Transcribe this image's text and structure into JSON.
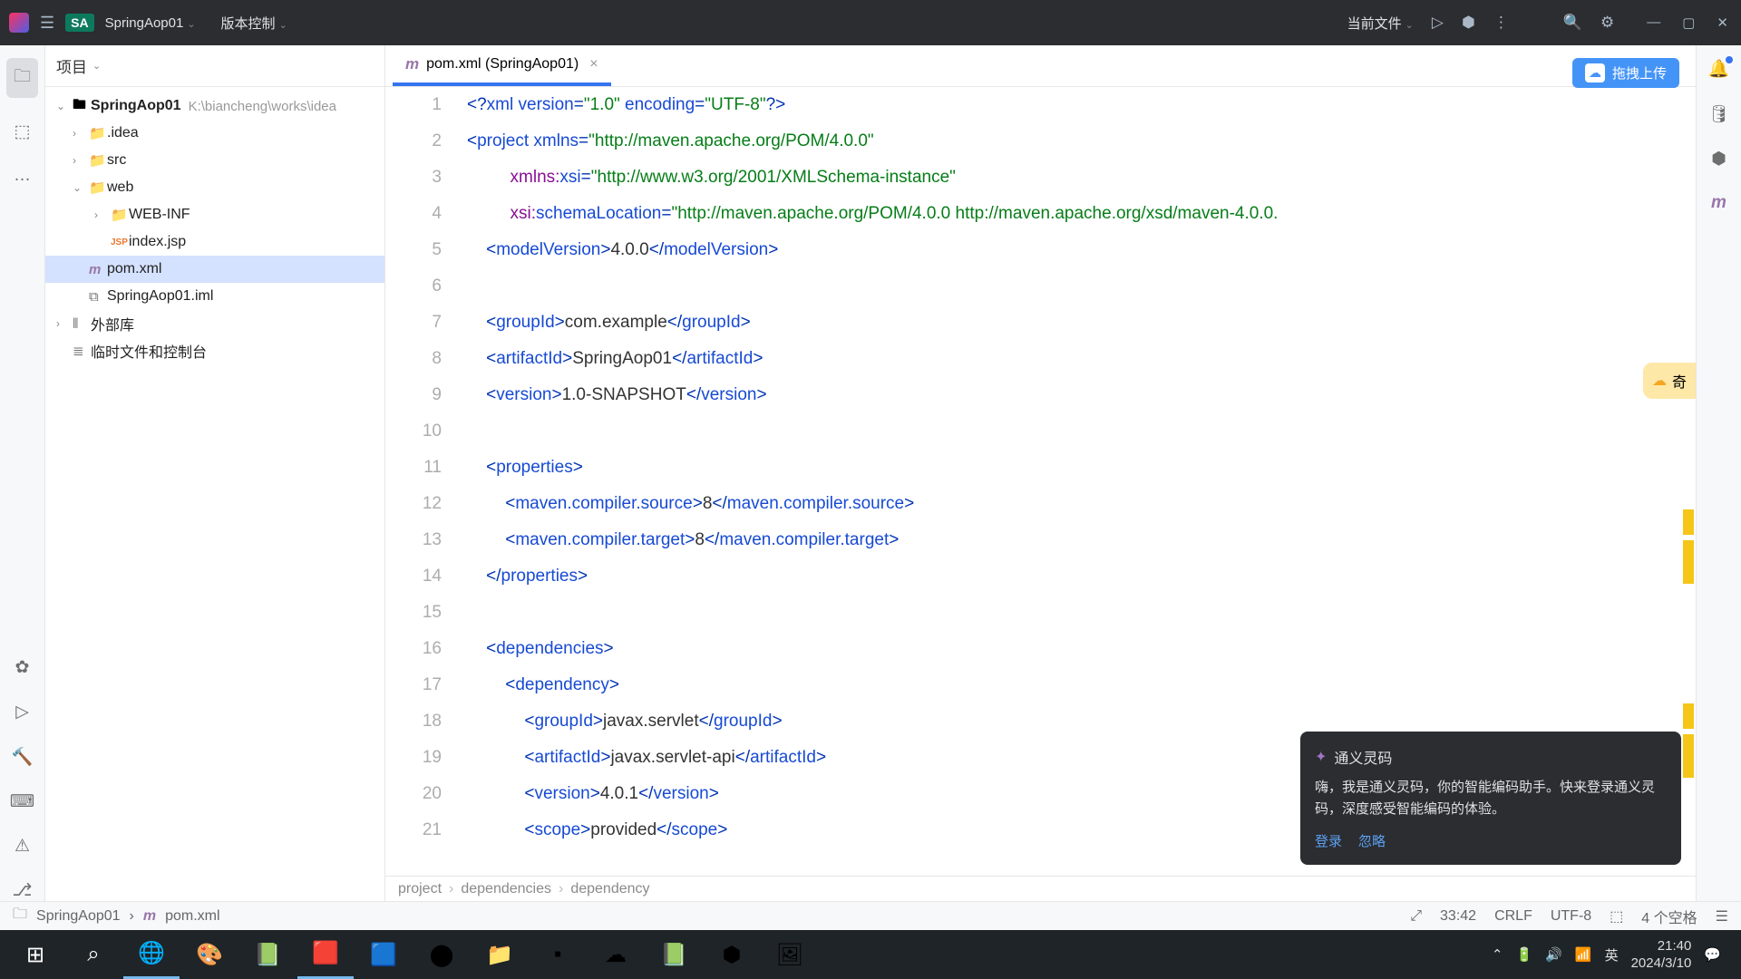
{
  "titlebar": {
    "project_short": "SA",
    "project_name": "SpringAop01",
    "menu_item": "版本控制",
    "current_file_label": "当前文件"
  },
  "project_panel": {
    "header": "项目",
    "root": {
      "name": "SpringAop01",
      "path": "K:\\biancheng\\works\\idea"
    },
    "items": [
      {
        "label": ".idea",
        "indent": 1,
        "chevron": "›",
        "icon": "📁"
      },
      {
        "label": "src",
        "indent": 1,
        "chevron": "›",
        "icon": "📁"
      },
      {
        "label": "web",
        "indent": 1,
        "chevron": "⌄",
        "icon": "📁"
      },
      {
        "label": "WEB-INF",
        "indent": 2,
        "chevron": "›",
        "icon": "📁"
      },
      {
        "label": "index.jsp",
        "indent": 2,
        "chevron": "",
        "icon": "jsp"
      },
      {
        "label": "pom.xml",
        "indent": 1,
        "chevron": "",
        "icon": "m",
        "selected": true
      },
      {
        "label": "SpringAop01.iml",
        "indent": 1,
        "chevron": "",
        "icon": "⧉"
      },
      {
        "label": "外部库",
        "indent": 0,
        "chevron": "›",
        "icon": "⫴"
      },
      {
        "label": "临时文件和控制台",
        "indent": 0,
        "chevron": "",
        "icon": "≣"
      }
    ]
  },
  "tab": {
    "label": "pom.xml (SpringAop01)"
  },
  "upload_label": "拖拽上传",
  "promo_label": "奇",
  "code_lines": [
    {
      "n": 1,
      "segs": [
        [
          "tag",
          "<?"
        ],
        [
          "attr",
          "xml version"
        ],
        [
          "tag",
          "="
        ],
        [
          "str",
          "\"1.0\""
        ],
        [
          "tag",
          " "
        ],
        [
          "attr",
          "encoding"
        ],
        [
          "tag",
          "="
        ],
        [
          "str",
          "\"UTF-8\""
        ],
        [
          "tag",
          "?>"
        ]
      ]
    },
    {
      "n": 2,
      "segs": [
        [
          "tag",
          "<"
        ],
        [
          "attr",
          "project "
        ],
        [
          "attr",
          "xmlns"
        ],
        [
          "tag",
          "="
        ],
        [
          "str",
          "\"http://maven.apache.org/POM/4.0.0\""
        ]
      ]
    },
    {
      "n": 3,
      "segs": [
        [
          "tag",
          "         "
        ],
        [
          "ns",
          "xmlns:"
        ],
        [
          "attr",
          "xsi"
        ],
        [
          "tag",
          "="
        ],
        [
          "str",
          "\"http://www.w3.org/2001/XMLSchema-instance\""
        ]
      ]
    },
    {
      "n": 4,
      "segs": [
        [
          "tag",
          "         "
        ],
        [
          "ns",
          "xsi:"
        ],
        [
          "attr",
          "schemaLocation"
        ],
        [
          "tag",
          "="
        ],
        [
          "str",
          "\"http://maven.apache.org/POM/4.0.0 http://maven.apache.org/xsd/maven-4.0.0."
        ]
      ]
    },
    {
      "n": 5,
      "segs": [
        [
          "tag",
          "    <"
        ],
        [
          "attr",
          "modelVersion"
        ],
        [
          "tag",
          ">"
        ],
        [
          "text",
          "4.0.0"
        ],
        [
          "tag",
          "</"
        ],
        [
          "attr",
          "modelVersion"
        ],
        [
          "tag",
          ">"
        ]
      ]
    },
    {
      "n": 6,
      "segs": [
        [
          "text",
          ""
        ]
      ]
    },
    {
      "n": 7,
      "segs": [
        [
          "tag",
          "    <"
        ],
        [
          "attr",
          "groupId"
        ],
        [
          "tag",
          ">"
        ],
        [
          "text",
          "com.example"
        ],
        [
          "tag",
          "</"
        ],
        [
          "attr",
          "groupId"
        ],
        [
          "tag",
          ">"
        ]
      ]
    },
    {
      "n": 8,
      "segs": [
        [
          "tag",
          "    <"
        ],
        [
          "attr",
          "artifactId"
        ],
        [
          "tag",
          ">"
        ],
        [
          "text",
          "SpringAop01"
        ],
        [
          "tag",
          "</"
        ],
        [
          "attr",
          "artifactId"
        ],
        [
          "tag",
          ">"
        ]
      ]
    },
    {
      "n": 9,
      "segs": [
        [
          "tag",
          "    <"
        ],
        [
          "attr",
          "version"
        ],
        [
          "tag",
          ">"
        ],
        [
          "text",
          "1.0-SNAPSHOT"
        ],
        [
          "tag",
          "</"
        ],
        [
          "attr",
          "version"
        ],
        [
          "tag",
          ">"
        ]
      ]
    },
    {
      "n": 10,
      "segs": [
        [
          "text",
          ""
        ]
      ]
    },
    {
      "n": 11,
      "segs": [
        [
          "tag",
          "    <"
        ],
        [
          "attr",
          "properties"
        ],
        [
          "tag",
          ">"
        ]
      ]
    },
    {
      "n": 12,
      "segs": [
        [
          "tag",
          "        <"
        ],
        [
          "attr",
          "maven.compiler.source"
        ],
        [
          "tag",
          ">"
        ],
        [
          "text",
          "8"
        ],
        [
          "tag",
          "</"
        ],
        [
          "attr",
          "maven.compiler.source"
        ],
        [
          "tag",
          ">"
        ]
      ]
    },
    {
      "n": 13,
      "segs": [
        [
          "tag",
          "        <"
        ],
        [
          "attr",
          "maven.compiler.target"
        ],
        [
          "tag",
          ">"
        ],
        [
          "text",
          "8"
        ],
        [
          "tag",
          "</"
        ],
        [
          "attr",
          "maven.compiler.target"
        ],
        [
          "tag",
          ">"
        ]
      ]
    },
    {
      "n": 14,
      "segs": [
        [
          "tag",
          "    </"
        ],
        [
          "attr",
          "properties"
        ],
        [
          "tag",
          ">"
        ]
      ]
    },
    {
      "n": 15,
      "segs": [
        [
          "text",
          ""
        ]
      ]
    },
    {
      "n": 16,
      "segs": [
        [
          "tag",
          "    <"
        ],
        [
          "attr",
          "dependencies"
        ],
        [
          "tag",
          ">"
        ]
      ]
    },
    {
      "n": 17,
      "segs": [
        [
          "tag",
          "        <"
        ],
        [
          "attr",
          "dependency"
        ],
        [
          "tag",
          ">"
        ]
      ]
    },
    {
      "n": 18,
      "segs": [
        [
          "tag",
          "            <"
        ],
        [
          "attr",
          "groupId"
        ],
        [
          "tag",
          ">"
        ],
        [
          "text",
          "javax.servlet"
        ],
        [
          "tag",
          "</"
        ],
        [
          "attr",
          "groupId"
        ],
        [
          "tag",
          ">"
        ]
      ]
    },
    {
      "n": 19,
      "segs": [
        [
          "tag",
          "            <"
        ],
        [
          "attr",
          "artifactId"
        ],
        [
          "tag",
          ">"
        ],
        [
          "text",
          "javax.servlet-api"
        ],
        [
          "tag",
          "</"
        ],
        [
          "attr",
          "artifactId"
        ],
        [
          "tag",
          ">"
        ]
      ]
    },
    {
      "n": 20,
      "segs": [
        [
          "tag",
          "            <"
        ],
        [
          "attr",
          "version"
        ],
        [
          "tag",
          ">"
        ],
        [
          "text",
          "4.0.1"
        ],
        [
          "tag",
          "</"
        ],
        [
          "attr",
          "version"
        ],
        [
          "tag",
          ">"
        ]
      ]
    },
    {
      "n": 21,
      "segs": [
        [
          "tag",
          "            <"
        ],
        [
          "attr",
          "scope"
        ],
        [
          "tag",
          ">"
        ],
        [
          "text",
          "provided"
        ],
        [
          "tag",
          "</"
        ],
        [
          "attr",
          "scope"
        ],
        [
          "tag",
          ">"
        ]
      ]
    }
  ],
  "breadcrumbs": [
    "project",
    "dependencies",
    "dependency"
  ],
  "popup": {
    "title": "通义灵码",
    "body": "嗨，我是通义灵码，你的智能编码助手。快来登录通义灵码，深度感受智能编码的体验。",
    "login": "登录",
    "ignore": "忽略"
  },
  "status_bar": {
    "file_path_root": "SpringAop01",
    "file_name": "pom.xml",
    "cursor": "33:42",
    "eol": "CRLF",
    "encoding": "UTF-8",
    "indent": "4 个空格"
  },
  "taskbar": {
    "ime": "英",
    "time": "21:40",
    "date": "2024/3/10"
  }
}
